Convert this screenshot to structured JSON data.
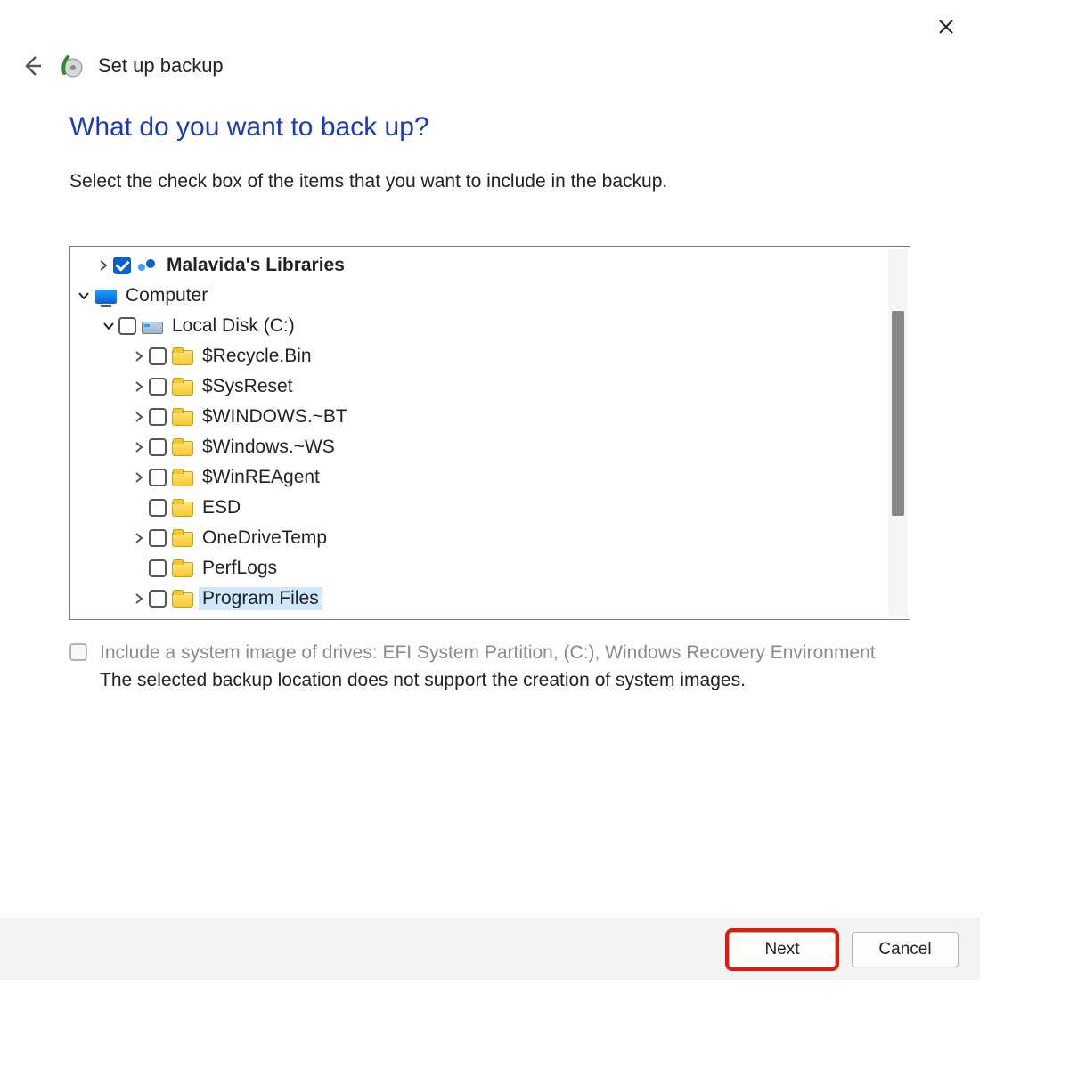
{
  "window": {
    "title": "Set up backup"
  },
  "page": {
    "heading": "What do you want to back up?",
    "instruction": "Select the check box of the items that you want to include in the backup."
  },
  "tree": {
    "libraries": {
      "label": "Malavida's Libraries",
      "checked": true
    },
    "computer": {
      "label": "Computer"
    },
    "disk": {
      "label": "Local Disk (C:)",
      "checked": false
    },
    "folders": [
      {
        "label": "$Recycle.Bin",
        "hasChildren": true,
        "checked": false,
        "selected": false
      },
      {
        "label": "$SysReset",
        "hasChildren": true,
        "checked": false,
        "selected": false
      },
      {
        "label": "$WINDOWS.~BT",
        "hasChildren": true,
        "checked": false,
        "selected": false
      },
      {
        "label": "$Windows.~WS",
        "hasChildren": true,
        "checked": false,
        "selected": false
      },
      {
        "label": "$WinREAgent",
        "hasChildren": true,
        "checked": false,
        "selected": false
      },
      {
        "label": "ESD",
        "hasChildren": false,
        "checked": false,
        "selected": false
      },
      {
        "label": "OneDriveTemp",
        "hasChildren": true,
        "checked": false,
        "selected": false
      },
      {
        "label": "PerfLogs",
        "hasChildren": false,
        "checked": false,
        "selected": false
      },
      {
        "label": "Program Files",
        "hasChildren": true,
        "checked": false,
        "selected": true
      }
    ]
  },
  "systemImage": {
    "label": "Include a system image of drives: EFI System Partition, (C:), Windows Recovery Environment",
    "note": "The selected backup location does not support the creation of system images.",
    "enabled": false
  },
  "buttons": {
    "next": "Next",
    "cancel": "Cancel"
  }
}
